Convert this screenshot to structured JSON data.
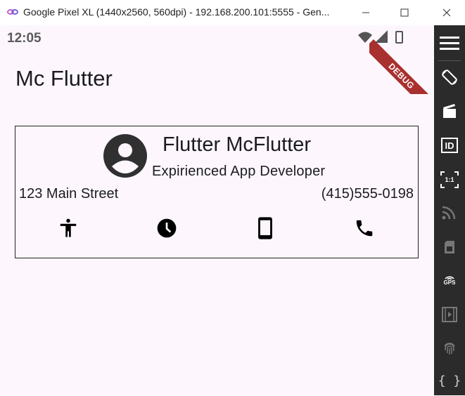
{
  "window": {
    "title": "Google Pixel XL (1440x2560, 560dpi) - 192.168.200.101:5555 - Gen..."
  },
  "statusbar": {
    "time": "12:05"
  },
  "debug_banner": {
    "label": "DEBUG"
  },
  "appbar": {
    "title": "Mc Flutter"
  },
  "card": {
    "name": "Flutter McFlutter",
    "job_title": "Expirienced App Developer",
    "address": "123 Main Street",
    "phone": "(415)555-0198",
    "icons": [
      "accessibility-icon",
      "clock-icon",
      "smartphone-icon",
      "phone-call-icon"
    ]
  },
  "sidebar": {
    "icons": [
      "menu-icon",
      "rotate-icon",
      "clapperboard-icon",
      "id-icon",
      "one-to-one-icon",
      "cast-icon",
      "sim-card-icon",
      "gps-icon",
      "video-capture-icon",
      "fingerprint-icon",
      "braces-icon"
    ],
    "id_label": "ID",
    "one_to_one_label": "1:1",
    "gps_label": "GPS",
    "braces_label": "{ }"
  },
  "colors": {
    "background": "#fdf7fd",
    "sidebar": "#2b2b2b",
    "debug_ribbon": "#a8302f",
    "avatar": "#303030"
  }
}
